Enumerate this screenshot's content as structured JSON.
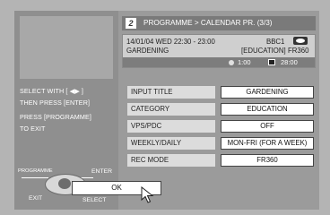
{
  "header": {
    "number": "2",
    "title": "PROGRAMME > CALENDAR PR. (3/3)"
  },
  "program_info": {
    "datetime": "14/01/04 WED 22:30 - 23:00",
    "channel": "BBC1",
    "name": "GARDENING",
    "category": "[EDUCATION]",
    "rec_mode": "FR360",
    "duration": "1:00",
    "remaining": "28:00"
  },
  "instructions": {
    "line1": "SELECT WITH [ ◀▶ ]",
    "line2": "THEN PRESS [ENTER]",
    "line3": "PRESS [PROGRAMME]",
    "line4": "TO EXIT"
  },
  "remote": {
    "programme": "PROGRAMME",
    "enter": "ENTER",
    "exit": "EXIT",
    "select": "SELECT"
  },
  "settings": [
    {
      "label": "INPUT TITLE",
      "value": "GARDENING"
    },
    {
      "label": "CATEGORY",
      "value": "EDUCATION"
    },
    {
      "label": "VPS/PDC",
      "value": "OFF"
    },
    {
      "label": "WEEKLY/DAILY",
      "value": "MON-FRI (FOR A WEEK)"
    },
    {
      "label": "REC MODE",
      "value": "FR360"
    }
  ],
  "ok_label": "OK",
  "icons": {
    "channel": "broadcast-icon",
    "disc": "disc-icon",
    "tape": "tape-icon",
    "cursor": "pointer-cursor-icon"
  }
}
